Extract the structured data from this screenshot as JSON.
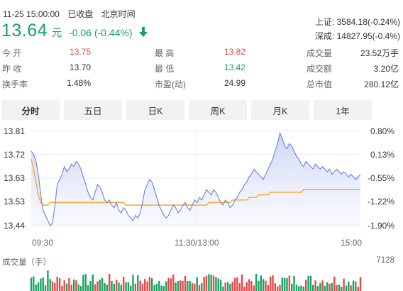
{
  "header": {
    "datetime": "11-25 15:00:00",
    "market_status": "已收盘",
    "timezone": "北京时间",
    "price": "13.64",
    "unit": "元",
    "change": "-0.06 (-0.44%)",
    "trend_icon": "down-arrow-icon"
  },
  "indices": [
    {
      "label": "上证:",
      "value": "3584.18(-0.24%)"
    },
    {
      "label": "深成:",
      "value": "14827.95(-0.4%)"
    }
  ],
  "stats": {
    "open_label": "今  开",
    "open": "13.75",
    "prev_label": "昨  收",
    "prev": "13.70",
    "turnover_label": "换手率",
    "turnover": "1.48%",
    "high_label": "最  高",
    "high": "13.82",
    "low_label": "最  低",
    "low": "13.42",
    "pe_label": "市盈(动)",
    "pe": "24.99",
    "volume_label": "成交量",
    "volume": "23.52万手",
    "amount_label": "成交额",
    "amount": "3.20亿",
    "mktcap_label": "总市值",
    "mktcap": "280.12亿"
  },
  "tabs": [
    "分时",
    "五日",
    "日K",
    "周K",
    "月K",
    "1年"
  ],
  "active_tab": "分时",
  "chart": {
    "y_left": [
      "13.81",
      "13.72",
      "13.63",
      "13.53",
      "13.44"
    ],
    "y_right": [
      "0.80%",
      "0.13%",
      "-0.55%",
      "-1.22%",
      "-1.90%"
    ],
    "x_labels": [
      "09:30",
      "11:30/13:00",
      "15:00"
    ],
    "volume_label": "成交量（手）",
    "volume_max": "7128"
  },
  "colors": {
    "up": "#e34a4a",
    "down": "#1aa260",
    "price_line": "#6b7fe3",
    "avg_line": "#f5a623"
  },
  "chart_data": {
    "type": "line",
    "ylim": [
      13.44,
      13.81
    ],
    "x_range": [
      "09:30",
      "15:00"
    ],
    "series": [
      {
        "values": [
          13.73,
          13.72,
          13.69,
          13.64,
          13.56,
          13.5,
          13.48,
          13.46,
          13.44,
          13.45,
          13.52,
          13.6,
          13.62,
          13.64,
          13.67,
          13.65,
          13.66,
          13.68,
          13.67,
          13.69,
          13.68,
          13.66,
          13.63,
          13.6,
          13.57,
          13.55,
          13.54,
          13.57,
          13.6,
          13.59,
          13.57,
          13.54,
          13.53,
          13.54,
          13.52,
          13.51,
          13.53,
          13.5,
          13.49,
          13.51,
          13.5,
          13.48,
          13.47,
          13.46,
          13.48,
          13.47,
          13.49,
          13.53,
          13.58,
          13.6,
          13.62,
          13.61,
          13.58,
          13.55,
          13.52,
          13.5,
          13.48,
          13.47,
          13.48,
          13.5,
          13.52,
          13.51,
          13.49,
          13.5,
          13.52,
          13.53,
          13.51,
          13.5,
          13.52,
          13.54,
          13.53,
          13.55,
          13.54,
          13.56,
          13.58,
          13.57,
          13.56,
          13.58,
          13.57,
          13.55,
          13.53,
          13.52,
          13.54,
          13.53,
          13.51,
          13.52,
          13.54,
          13.55,
          13.57,
          13.58,
          13.6,
          13.61,
          13.63,
          13.64,
          13.66,
          13.65,
          13.64,
          13.63,
          13.62,
          13.64,
          13.66,
          13.68,
          13.7,
          13.73,
          13.76,
          13.8,
          13.78,
          13.75,
          13.74,
          13.76,
          13.75,
          13.73,
          13.71,
          13.7,
          13.68,
          13.67,
          13.69,
          13.68,
          13.67,
          13.66,
          13.68,
          13.67,
          13.66,
          13.67,
          13.66,
          13.65,
          13.66,
          13.64,
          13.65,
          13.66,
          13.65,
          13.64,
          13.65,
          13.64,
          13.63,
          13.64,
          13.63,
          13.62,
          13.63,
          13.64
        ]
      },
      {
        "values": [
          13.7,
          13.66,
          13.61,
          13.56,
          13.53,
          13.52,
          13.52,
          13.52,
          13.53,
          13.53,
          13.53,
          13.53,
          13.53,
          13.53,
          13.53,
          13.53,
          13.53,
          13.53,
          13.53,
          13.53,
          13.53,
          13.53,
          13.53,
          13.53,
          13.53,
          13.53,
          13.53,
          13.53,
          13.53,
          13.53,
          13.53,
          13.53,
          13.53,
          13.53,
          13.53,
          13.53,
          13.53,
          13.53,
          13.53,
          13.53,
          13.52,
          13.52,
          13.52,
          13.52,
          13.52,
          13.52,
          13.52,
          13.52,
          13.52,
          13.52,
          13.52,
          13.52,
          13.52,
          13.52,
          13.52,
          13.52,
          13.52,
          13.52,
          13.52,
          13.52,
          13.52,
          13.52,
          13.52,
          13.52,
          13.52,
          13.52,
          13.52,
          13.52,
          13.52,
          13.52,
          13.52,
          13.52,
          13.52,
          13.52,
          13.52,
          13.53,
          13.53,
          13.53,
          13.53,
          13.53,
          13.53,
          13.53,
          13.53,
          13.53,
          13.53,
          13.54,
          13.54,
          13.54,
          13.54,
          13.54,
          13.54,
          13.54,
          13.55,
          13.55,
          13.55,
          13.55,
          13.56,
          13.56,
          13.56,
          13.56,
          13.56,
          13.57,
          13.57,
          13.57,
          13.57,
          13.57,
          13.57,
          13.57,
          13.57,
          13.57,
          13.57,
          13.57,
          13.57,
          13.57,
          13.57,
          13.58,
          13.58,
          13.58,
          13.58,
          13.58,
          13.58,
          13.58,
          13.58,
          13.58,
          13.58,
          13.58,
          13.58,
          13.58,
          13.58,
          13.58,
          13.58,
          13.58,
          13.58,
          13.58,
          13.58,
          13.58,
          13.58,
          13.58,
          13.58,
          13.58
        ]
      }
    ]
  }
}
